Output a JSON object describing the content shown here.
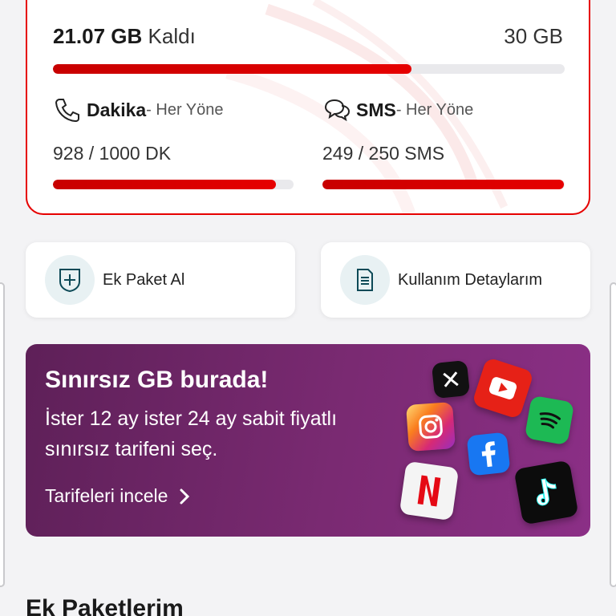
{
  "usage": {
    "data": {
      "remaining_value": "21.07 GB",
      "remaining_suffix": "Kaldı",
      "total": "30 GB",
      "remaining_fraction": 0.7
    },
    "minutes": {
      "label": "Dakika",
      "direction": "- Her Yöne",
      "value": "928 / 1000 DK",
      "remaining_fraction": 0.928
    },
    "sms": {
      "label": "SMS",
      "direction": "- Her Yöne",
      "value": "249 / 250 SMS",
      "remaining_fraction": 0.996
    }
  },
  "actions": {
    "buy_extra_label": "Ek Paket Al",
    "usage_details_label": "Kullanım Detaylarım"
  },
  "promo": {
    "title": "Sınırsız GB burada!",
    "description": "İster 12 ay ister 24 ay sabit fiyatlı sınırsız tarifeni seç.",
    "cta": "Tarifeleri incele",
    "icons": [
      "x-icon",
      "youtube-icon",
      "instagram-icon",
      "spotify-icon",
      "facebook-icon",
      "netflix-icon",
      "tiktok-icon"
    ]
  },
  "sections": {
    "extra_packages_title": "Ek Paketlerim"
  },
  "colors": {
    "accent": "#e60000",
    "promo_bg": "#7a2a72",
    "action_icon_bg": "#e8f1f3"
  }
}
